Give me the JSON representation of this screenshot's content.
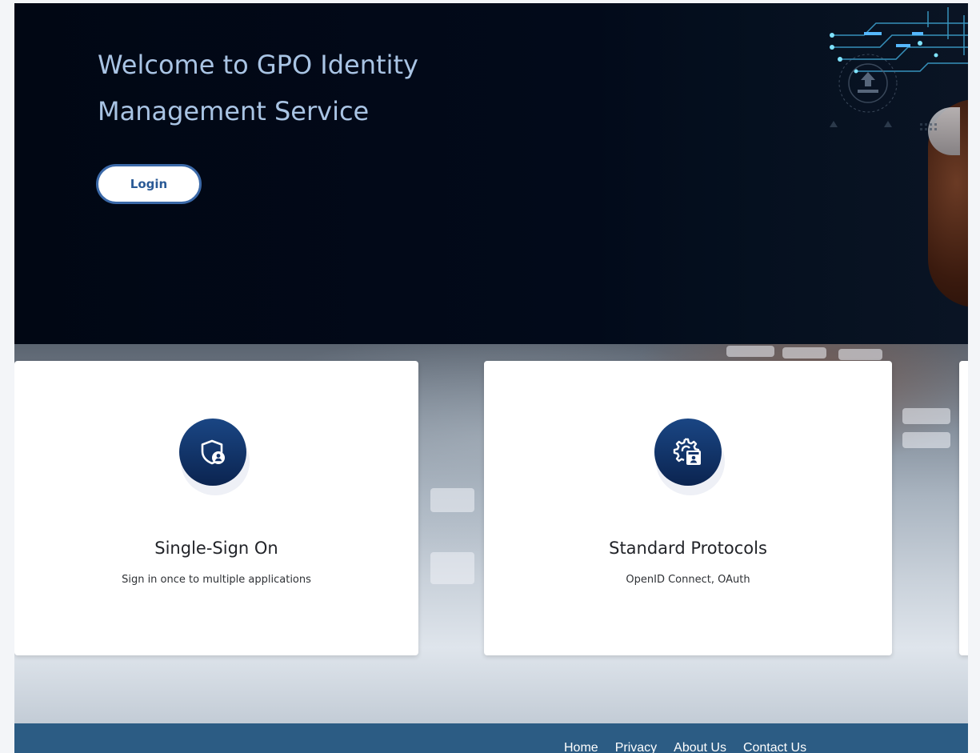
{
  "hero": {
    "title_line1": "Welcome to GPO Identity",
    "title_line2": "Management Service",
    "login_label": "Login"
  },
  "features": [
    {
      "title": "Single-Sign On",
      "description": "Sign in once to multiple applications",
      "icon": "shield-user-icon"
    },
    {
      "title": "Standard Protocols",
      "description": "OpenID Connect, OAuth",
      "icon": "gear-badge-icon"
    }
  ],
  "footer": {
    "links": [
      "Home",
      "Privacy",
      "About Us",
      "Contact Us"
    ]
  },
  "colors": {
    "hero_background": "#020a1a",
    "hero_title": "#a9c4e4",
    "login_button_border": "#3b69a8",
    "login_button_text": "#2a5a96",
    "feature_icon_background": "#12336a",
    "footer_background": "#2c5c84"
  }
}
